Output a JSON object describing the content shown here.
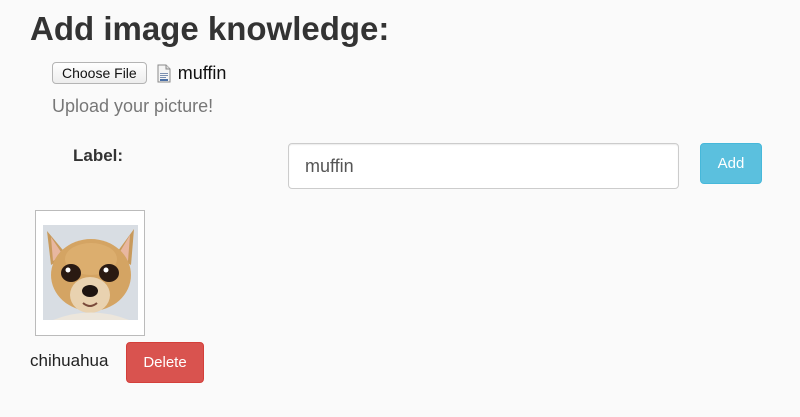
{
  "header": {
    "title": "Add image knowledge:"
  },
  "upload": {
    "choose_button_label": "Choose File",
    "file_icon": "document-icon",
    "selected_file_name": "muffin",
    "help_text": "Upload your picture!"
  },
  "label_form": {
    "label": "Label:",
    "input_value": "muffin",
    "add_button_label": "Add"
  },
  "knowledge_items": [
    {
      "label": "chihuahua",
      "delete_button_label": "Delete"
    }
  ],
  "colors": {
    "add_button": "#5bc0de",
    "delete_button": "#d9534f",
    "help_text": "#777777"
  }
}
